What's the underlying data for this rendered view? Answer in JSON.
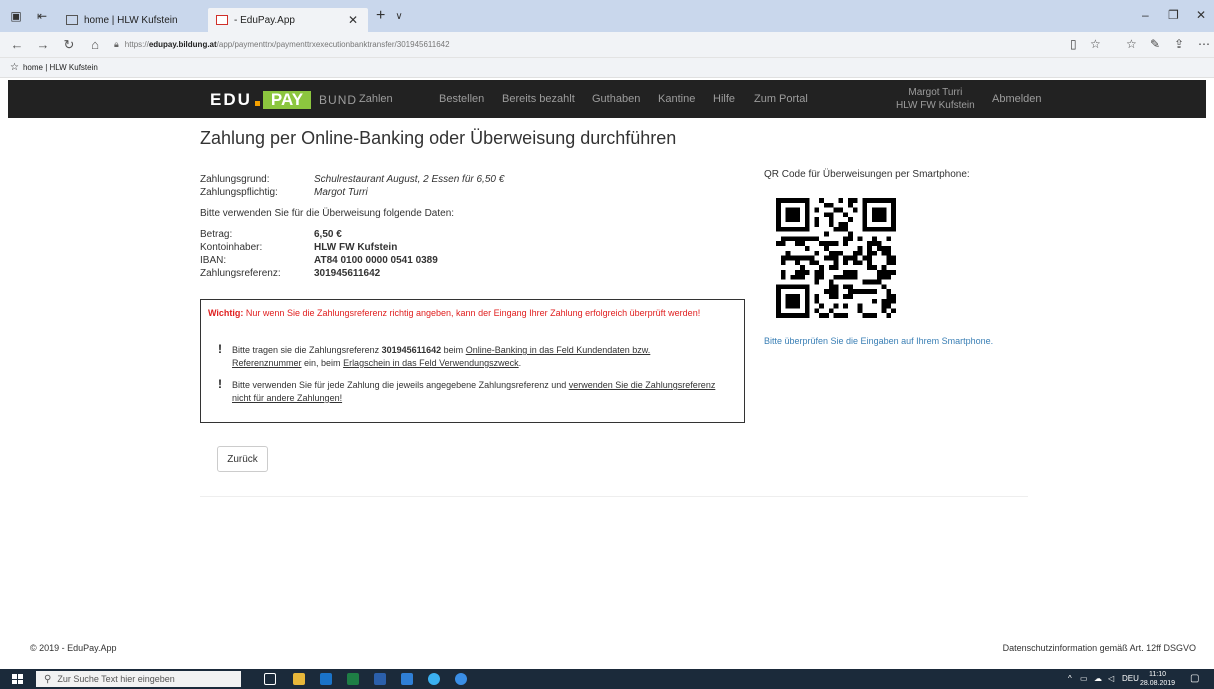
{
  "browser": {
    "tabs": [
      {
        "label": "home | HLW Kufstein"
      },
      {
        "label": "- EduPay.App"
      }
    ],
    "url_prefix": "https://",
    "url_host": "edupay.bildung.at",
    "url_path": "/app/paymenttrx/paymenttrxexecutionbanktransfer/301945611642",
    "favorites": [
      {
        "label": "home | HLW Kufstein"
      }
    ]
  },
  "logo": {
    "edu": "EDU",
    "pay": "PAY",
    "bund": "BUND"
  },
  "nav": {
    "items": [
      "Zahlen",
      "Bestellen",
      "Bereits bezahlt",
      "Guthaben",
      "Kantine",
      "Hilfe",
      "Zum Portal"
    ],
    "user_name": "Margot Turri",
    "user_school": "HLW FW Kufstein",
    "logout": "Abmelden"
  },
  "page": {
    "title": "Zahlung per Online-Banking oder Überweisung durchführen",
    "zahlungsgrund_label": "Zahlungsgrund:",
    "zahlungsgrund_value": "Schulrestaurant August, 2 Essen für 6,50 €",
    "pflichtig_label": "Zahlungspflichtig:",
    "pflichtig_value": "Margot Turri",
    "instruction": "Bitte verwenden Sie für die Überweisung folgende Daten:",
    "betrag_label": "Betrag:",
    "betrag_value": "6,50 €",
    "inhaber_label": "Kontoinhaber:",
    "inhaber_value": "HLW FW Kufstein",
    "iban_label": "IBAN:",
    "iban_value": "AT84 0100 0000 0541 0389",
    "referenz_label": "Zahlungsreferenz:",
    "referenz_value": "301945611642"
  },
  "warning": {
    "head_bold": "Wichtig:",
    "head_text": " Nur wenn Sie die Zahlungsreferenz richtig angeben, kann der Eingang Ihrer Zahlung erfolgreich überprüft werden!",
    "b1_pre": "Bitte tragen sie die Zahlungsreferenz ",
    "b1_ref": "301945611642",
    "b1_mid": " beim ",
    "b1_link1": "Online-Banking in das Feld Kundendaten bzw. Referenznummer",
    "b1_mid2": " ein, beim ",
    "b1_link2": "Erlagschein in das Feld Verwendungszweck",
    "b1_end": ".",
    "b2_pre": "Bitte verwenden Sie für jede Zahlung die jeweils angegebene Zahlungsreferenz und ",
    "b2_link": "verwenden Sie die Zahlungsreferenz nicht für andere Zahlungen!"
  },
  "qr": {
    "label": "QR Code für Überweisungen per Smartphone:",
    "note": "Bitte überprüfen Sie die Eingaben auf Ihrem Smartphone."
  },
  "buttons": {
    "back": "Zurück"
  },
  "footer": {
    "copyright": "© 2019 - EduPay.App",
    "privacy": "Datenschutzinformation gemäß Art. 12ff DSGVO"
  },
  "taskbar": {
    "search_placeholder": "Zur Suche Text hier eingeben",
    "lang": "DEU",
    "time": "11:10",
    "date": "28.08.2019"
  },
  "colors": {
    "navbar": "#222222",
    "pay_green": "#8cc63f",
    "accent_orange": "#f5a100",
    "warning_red": "#e02020",
    "link_blue": "#3a7fb5"
  }
}
